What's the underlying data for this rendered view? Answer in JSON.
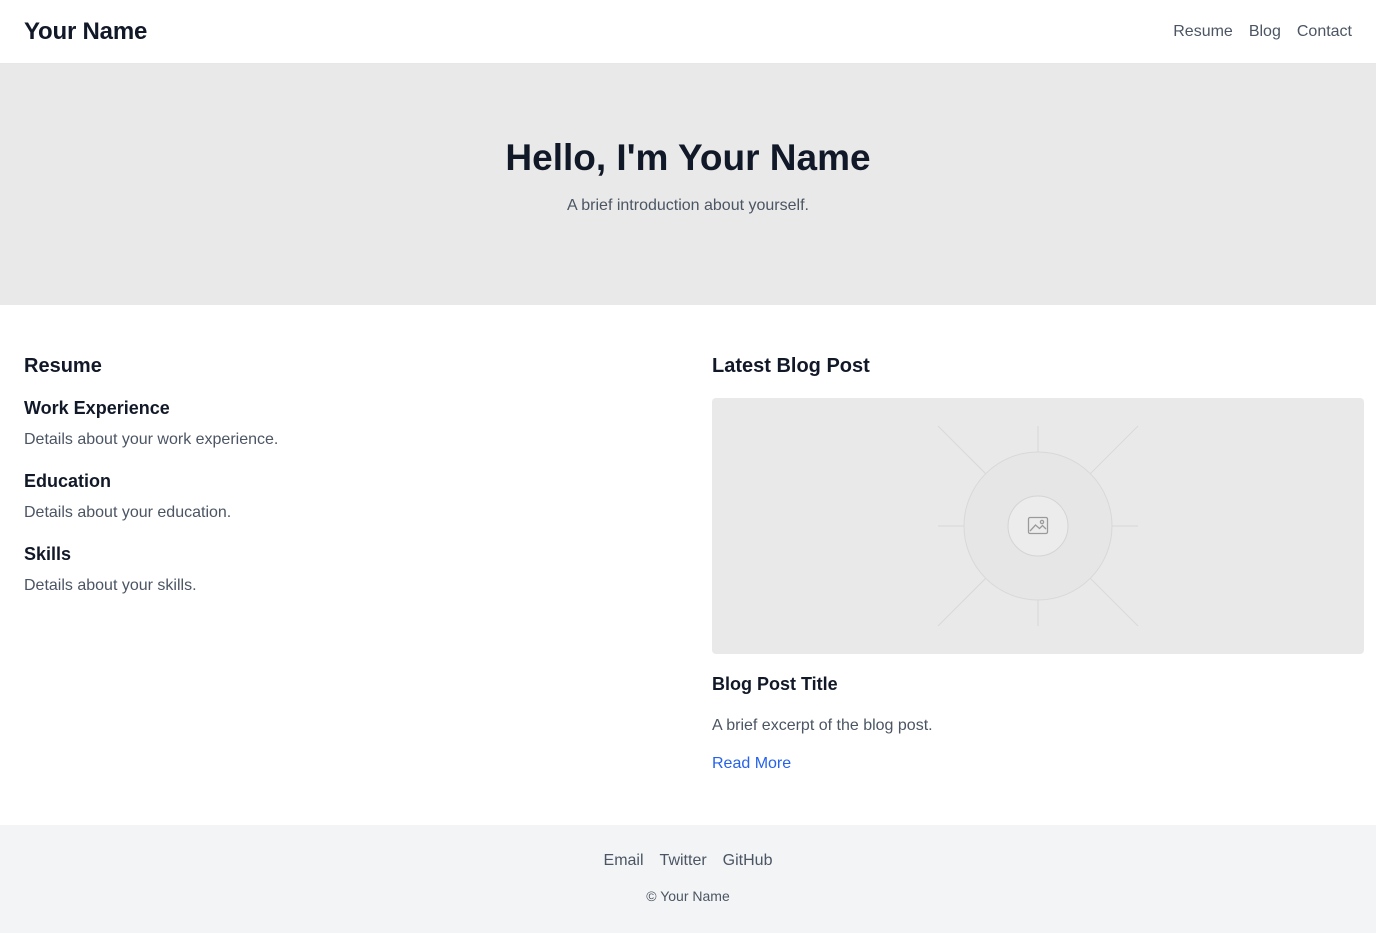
{
  "header": {
    "site_title": "Your Name",
    "nav": [
      {
        "label": "Resume"
      },
      {
        "label": "Blog"
      },
      {
        "label": "Contact"
      }
    ]
  },
  "hero": {
    "title": "Hello, I'm Your Name",
    "subtitle": "A brief introduction about yourself."
  },
  "resume": {
    "heading": "Resume",
    "items": [
      {
        "title": "Work Experience",
        "text": "Details about your work experience."
      },
      {
        "title": "Education",
        "text": "Details about your education."
      },
      {
        "title": "Skills",
        "text": "Details about your skills."
      }
    ]
  },
  "blog": {
    "heading": "Latest Blog Post",
    "image_icon": "image-icon",
    "post_title": "Blog Post Title",
    "excerpt": "A brief excerpt of the blog post.",
    "read_more": "Read More"
  },
  "footer": {
    "links": [
      {
        "label": "Email"
      },
      {
        "label": "Twitter"
      },
      {
        "label": "GitHub"
      }
    ],
    "copyright": "© Your Name"
  },
  "colors": {
    "accent_link": "#2563eb",
    "hero_bg": "#e9e9e9",
    "footer_bg": "#f3f4f6"
  }
}
